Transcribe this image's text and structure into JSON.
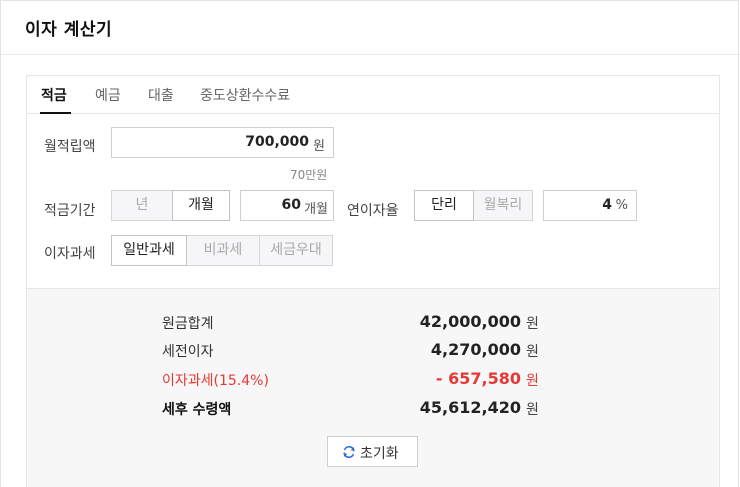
{
  "header": {
    "title": "이자 계산기"
  },
  "tabs": [
    {
      "label": "적금",
      "active": true
    },
    {
      "label": "예금",
      "active": false
    },
    {
      "label": "대출",
      "active": false
    },
    {
      "label": "중도상환수수료",
      "active": false
    }
  ],
  "form": {
    "monthly_label": "월적립액",
    "monthly_value": "700,000",
    "monthly_unit": "원",
    "monthly_hint": "70만원",
    "period_label": "적금기간",
    "period_options": [
      "년",
      "개월"
    ],
    "period_selected": "개월",
    "period_value": "60",
    "period_unit": "개월",
    "rate_label": "연이자율",
    "rate_options": [
      "단리",
      "월복리"
    ],
    "rate_selected": "단리",
    "rate_value": "4",
    "rate_unit": "%",
    "tax_label": "이자과세",
    "tax_options": [
      "일반과세",
      "비과세",
      "세금우대"
    ],
    "tax_selected": "일반과세"
  },
  "results": {
    "principal_label": "원금합계",
    "principal_value": "42,000,000",
    "pretax_label": "세전이자",
    "pretax_value": "4,270,000",
    "tax_label": "이자과세(15.4%)",
    "tax_value": "- 657,580",
    "net_label": "세후 수령액",
    "net_value": "45,612,420",
    "unit": "원",
    "reset_label": "초기화"
  },
  "colors": {
    "accent_red": "#e53935",
    "refresh_icon": "#2b6fd6"
  },
  "icons": {
    "reset": "refresh-icon"
  }
}
